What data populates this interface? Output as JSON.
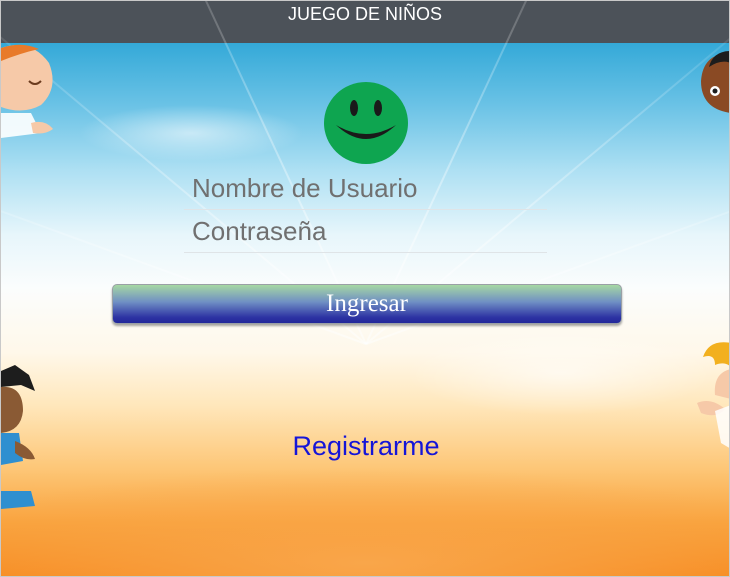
{
  "header": {
    "title": "JUEGO DE NIÑOS"
  },
  "login_form": {
    "username_placeholder": "Nombre de Usuario",
    "password_placeholder": "Contraseña",
    "submit_label": "Ingresar"
  },
  "register_link": {
    "label": "Registrarme"
  },
  "colors": {
    "header_bg": "#4c5259",
    "smiley": "#0ea550",
    "link": "#1515d8"
  }
}
